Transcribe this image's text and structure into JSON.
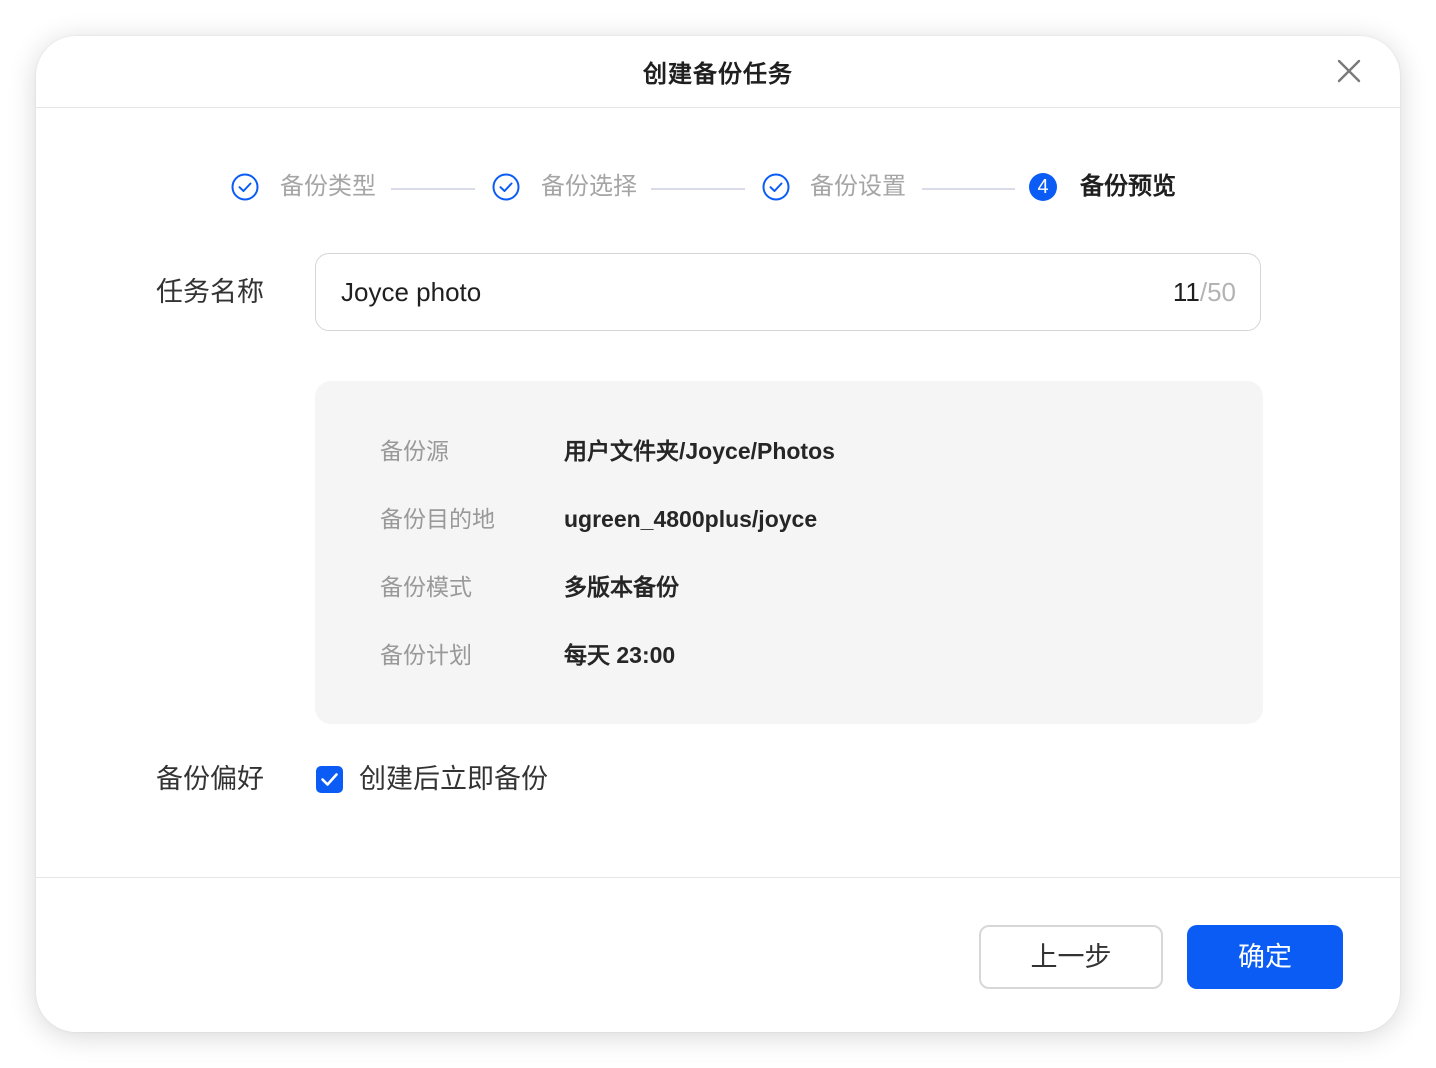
{
  "dialog": {
    "title": "创建备份任务"
  },
  "steps": [
    {
      "label": "备份类型",
      "status": "done"
    },
    {
      "label": "备份选择",
      "status": "done"
    },
    {
      "label": "备份设置",
      "status": "done"
    },
    {
      "label": "备份预览",
      "status": "active",
      "number": "4"
    }
  ],
  "form": {
    "task_name_label": "任务名称",
    "task_name_value": "Joyce photo",
    "task_name_count": "11",
    "task_name_max": "/50",
    "summary": [
      {
        "key": "备份源",
        "value": "用户文件夹/Joyce/Photos"
      },
      {
        "key": "备份目的地",
        "value": "ugreen_4800plus/joyce"
      },
      {
        "key": "备份模式",
        "value": "多版本备份"
      },
      {
        "key": "备份计划",
        "value": "每天 23:00"
      }
    ],
    "preference_label": "备份偏好",
    "backup_now_label": "创建后立即备份",
    "backup_now_checked": true
  },
  "footer": {
    "prev_label": "上一步",
    "confirm_label": "确定"
  },
  "colors": {
    "accent": "#0a5cf5",
    "muted_text": "#a5a5a5"
  }
}
